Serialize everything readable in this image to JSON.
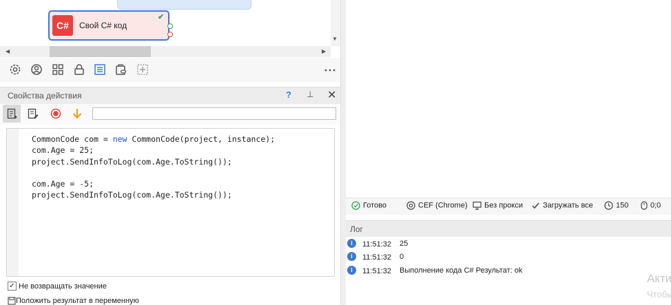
{
  "canvas": {
    "node": {
      "icon_text": "C#",
      "label": "Свой C# код",
      "status_mark": "✔"
    }
  },
  "toolbar_icons": [
    "gear-icon",
    "user-circle-icon",
    "grid-icon",
    "lock-icon",
    "list-icon",
    "database-icon",
    "add-box-icon",
    "more-icon"
  ],
  "properties": {
    "title": "Свойства действия",
    "help": "?",
    "pin": "⊥",
    "close": "✕",
    "input_value": "",
    "code_lines": [
      "CommonCode com = new CommonCode(project, instance);",
      "com.Age = 25;",
      "project.SendInfoToLog(com.Age.ToString());",
      "",
      "com.Age = -5;",
      "project.SendInfoToLog(com.Age.ToString());"
    ],
    "option_no_return": {
      "label": "Не возвращать значение",
      "checked": true
    },
    "option_to_variable": {
      "label": "Положить результат в переменную",
      "checked": false
    }
  },
  "status_bar": {
    "ready": "Готово",
    "browser": "CEF (Chrome)",
    "proxy": "Без прокси",
    "load": "Загружать все",
    "timeout": "150",
    "counter": "0;0"
  },
  "log": {
    "title": "Лог",
    "entries": [
      {
        "time": "11:51:32",
        "message": "25"
      },
      {
        "time": "11:51:32",
        "message": "0"
      },
      {
        "time": "11:51:32",
        "message": "Выполнение кода C#  Результат: ok"
      }
    ]
  },
  "watermark": {
    "line1": "Акти",
    "line2": "Чтобы"
  },
  "colors": {
    "accent": "#3b78d8",
    "csharp": "#e8413e",
    "ok": "#2ca45a",
    "info": "#3d77d0"
  }
}
